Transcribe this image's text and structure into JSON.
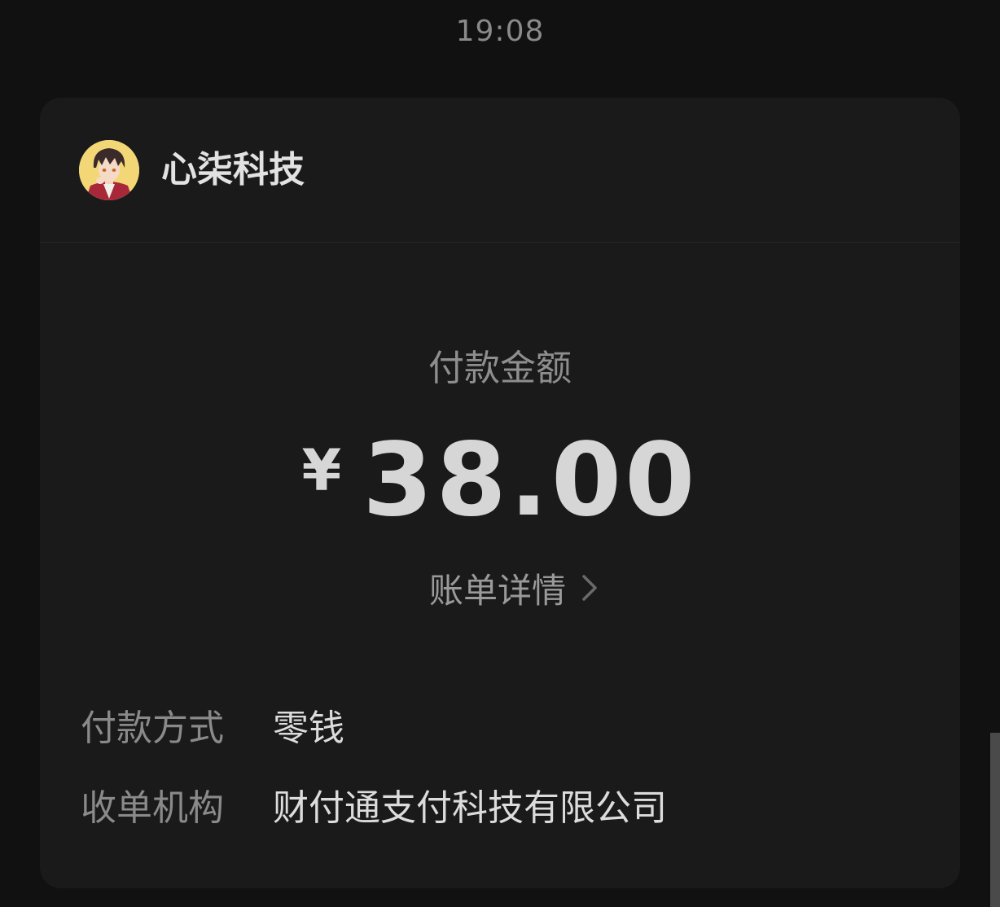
{
  "status": {
    "time": "19:08"
  },
  "merchant": {
    "name": "心柒科技",
    "avatar_icon": "anime-character-avatar"
  },
  "payment": {
    "amount_label": "付款金额",
    "currency": "¥",
    "amount": "38.00",
    "details_link": "账单详情"
  },
  "info_rows": [
    {
      "label": "付款方式",
      "value": "零钱"
    },
    {
      "label": "收单机构",
      "value": "财付通支付科技有限公司"
    }
  ],
  "colors": {
    "background": "#111111",
    "card": "#1a1a1a",
    "primary_text": "#d6d6d6",
    "secondary_text": "#8a8a8a"
  }
}
